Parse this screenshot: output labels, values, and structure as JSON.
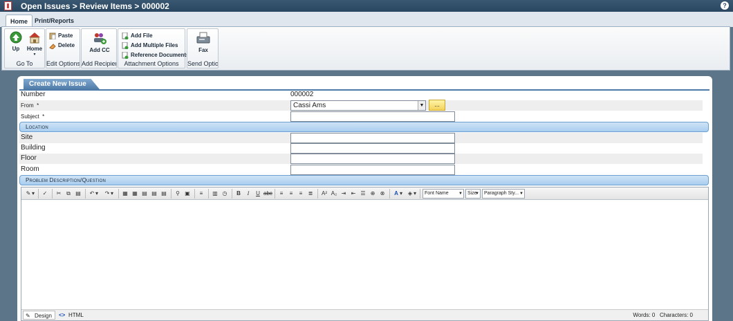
{
  "window": {
    "title": "Open Issues > Review Items > 000002",
    "help_label": "?"
  },
  "ribbon": {
    "tabs": [
      "Home",
      "Print/Reports"
    ],
    "groups": {
      "go_to": {
        "label": "Go To",
        "up": "Up",
        "home": "Home"
      },
      "edit": {
        "label": "Edit Options",
        "paste": "Paste",
        "delete": "Delete"
      },
      "recip": {
        "label": "Add Recipient",
        "add_cc": "Add CC"
      },
      "attach": {
        "label": "Attachment Options",
        "add_file": "Add File",
        "add_multiple": "Add Multiple Files",
        "reference": "Reference Documents"
      },
      "send": {
        "label": "Send Option",
        "fax": "Fax"
      }
    }
  },
  "form": {
    "panel_title": "Create New Issue",
    "number_label": "Number",
    "number_value": "000002",
    "from_label": "From",
    "required_mark": "*",
    "from_value": "Cassi Ams",
    "ellipsis": "...",
    "subject_label": "Subject",
    "location_section": "Location",
    "site_label": "Site",
    "building_label": "Building",
    "floor_label": "Floor",
    "room_label": "Room",
    "problem_section": "Problem Description/Question"
  },
  "editor": {
    "font_name": "Font Name",
    "size": "Size",
    "paragraph_style": "Paragraph Sty...",
    "design_tab": "Design",
    "html_tab": "HTML",
    "words_label": "Words: 0",
    "characters_label": "Characters: 0"
  },
  "colors": {
    "titlebar": "#2a4660",
    "accent": "#4d79a6",
    "section": "#a9cdef",
    "background": "#5d7589"
  }
}
